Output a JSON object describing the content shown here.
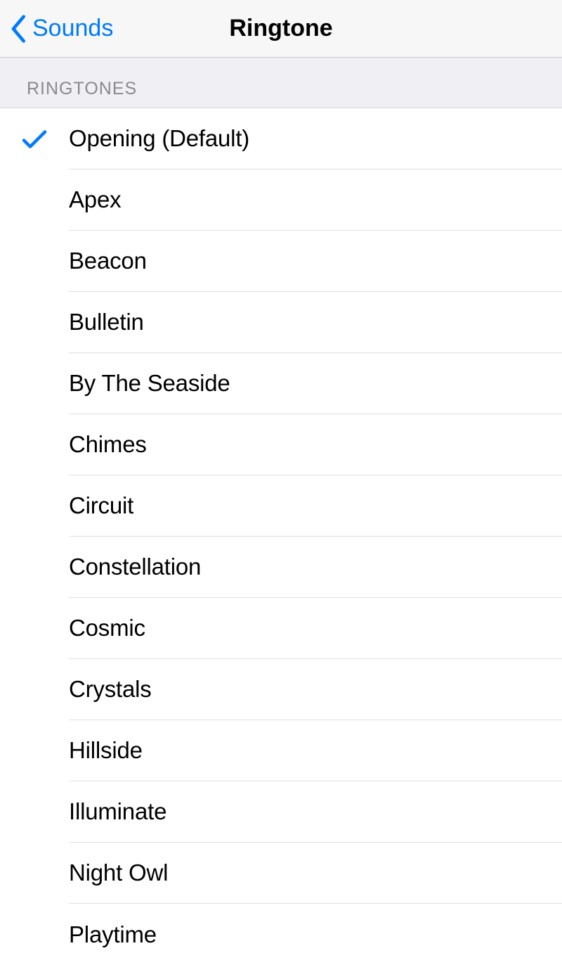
{
  "nav": {
    "back_label": "Sounds",
    "title": "Ringtone"
  },
  "section": {
    "header": "RINGTONES"
  },
  "ringtones": [
    {
      "label": "Opening (Default)",
      "selected": true
    },
    {
      "label": "Apex",
      "selected": false
    },
    {
      "label": "Beacon",
      "selected": false
    },
    {
      "label": "Bulletin",
      "selected": false
    },
    {
      "label": "By The Seaside",
      "selected": false
    },
    {
      "label": "Chimes",
      "selected": false
    },
    {
      "label": "Circuit",
      "selected": false
    },
    {
      "label": "Constellation",
      "selected": false
    },
    {
      "label": "Cosmic",
      "selected": false
    },
    {
      "label": "Crystals",
      "selected": false
    },
    {
      "label": "Hillside",
      "selected": false
    },
    {
      "label": "Illuminate",
      "selected": false
    },
    {
      "label": "Night Owl",
      "selected": false
    },
    {
      "label": "Playtime",
      "selected": false
    }
  ],
  "colors": {
    "accent": "#007aff",
    "header_bg": "#f7f7f8",
    "section_bg": "#efeff4",
    "separator": "#e0e0e3",
    "secondary_text": "#8a8a8e"
  }
}
